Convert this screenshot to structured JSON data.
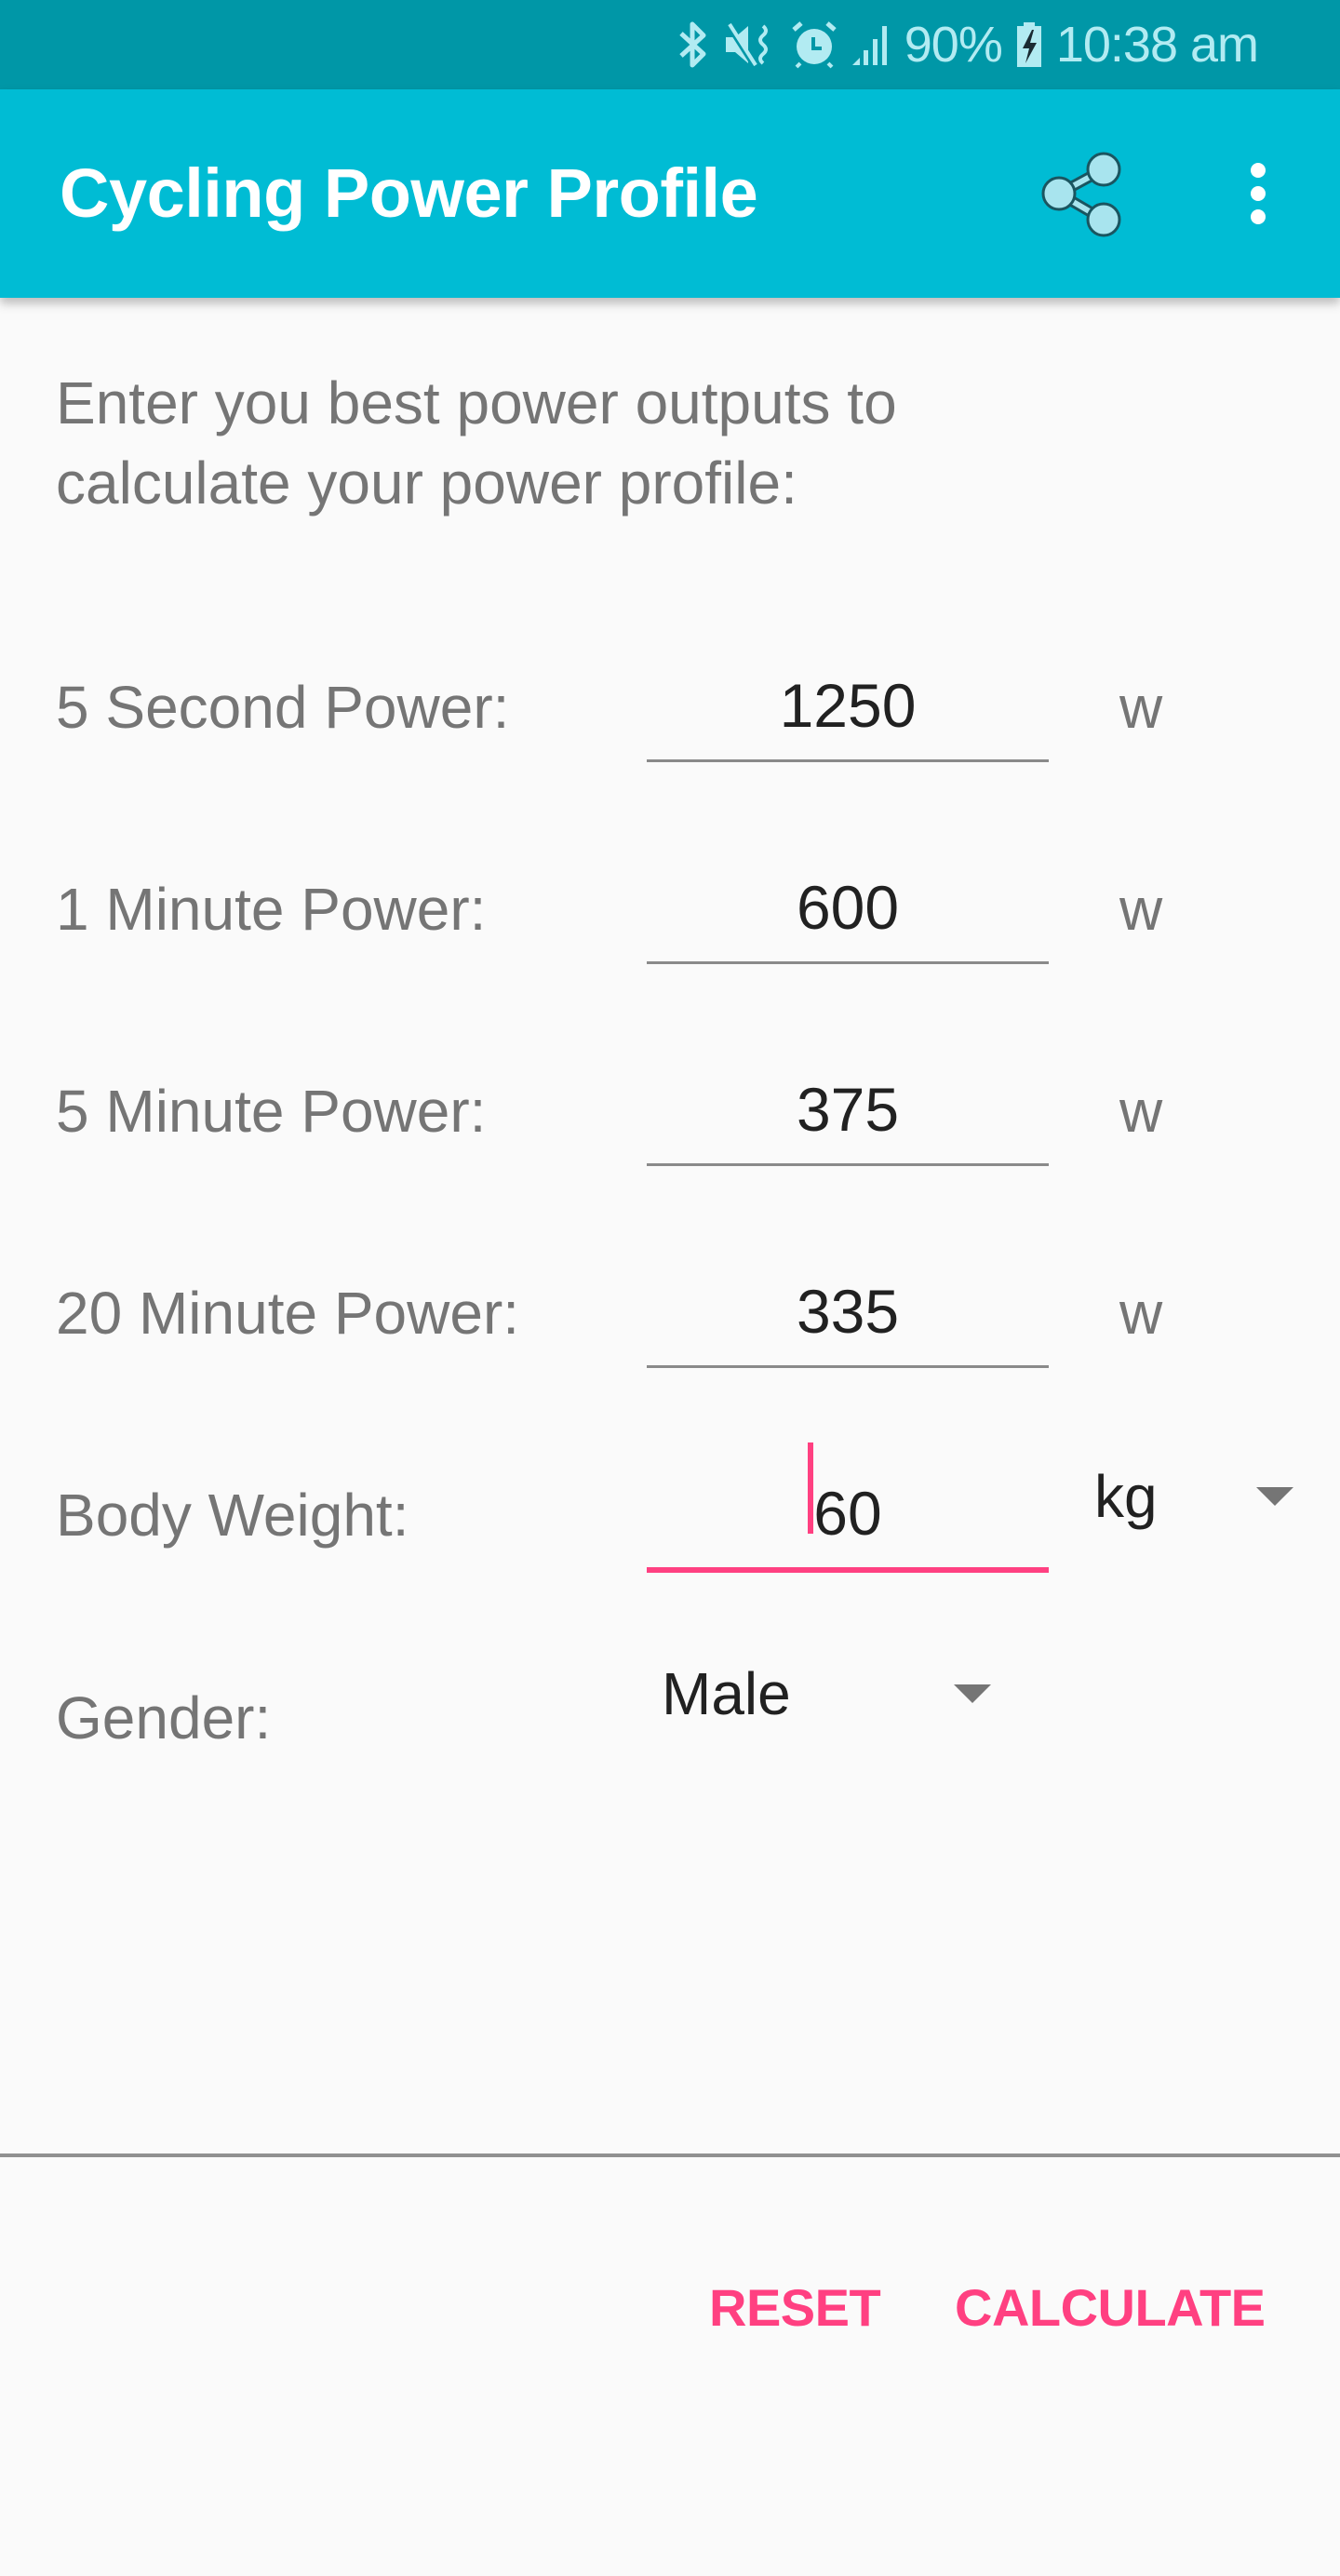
{
  "status_bar": {
    "icons": [
      "bluetooth-icon",
      "vibrate-mute-icon",
      "alarm-icon",
      "signal-icon",
      "battery-charging-icon"
    ],
    "battery": "90%",
    "time": "10:38 am"
  },
  "app_bar": {
    "title": "Cycling Power Profile",
    "actions": [
      "share-icon",
      "more-vert-icon"
    ]
  },
  "colors": {
    "primary": "#00bcd4",
    "primary_dark": "#0097a7",
    "accent": "#ff4081"
  },
  "intro_text": "Enter you best power outputs to calculate your power profile:",
  "form": {
    "rows": [
      {
        "label": "5 Second Power:",
        "value": "1250",
        "unit": "w"
      },
      {
        "label": "1 Minute Power:",
        "value": "600",
        "unit": "w"
      },
      {
        "label": "5 Minute Power:",
        "value": "375",
        "unit": "w"
      },
      {
        "label": "20 Minute Power:",
        "value": "335",
        "unit": "w"
      }
    ],
    "body_weight": {
      "label": "Body Weight:",
      "value": "60",
      "unit_selected": "kg"
    },
    "gender": {
      "label": "Gender:",
      "selected": "Male"
    }
  },
  "buttons": {
    "reset": "RESET",
    "calculate": "CALCULATE"
  }
}
